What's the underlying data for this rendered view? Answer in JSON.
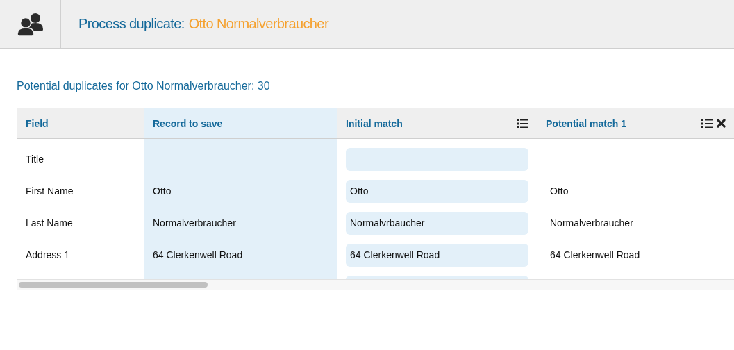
{
  "header": {
    "title": "Process duplicate:",
    "name": "Otto Normalverbraucher"
  },
  "summary": "Potential duplicates for Otto Normalverbraucher: 30",
  "table": {
    "columns": [
      {
        "label": "Field",
        "highlighted": false
      },
      {
        "label": "Record to save",
        "highlighted": true
      },
      {
        "label": "Initial match",
        "highlighted": false,
        "actions": [
          {
            "kind": "list"
          }
        ]
      },
      {
        "label": "Potential match 1",
        "highlighted": false,
        "actions": [
          {
            "kind": "list"
          },
          {
            "kind": "remove"
          }
        ]
      }
    ],
    "rows": [
      {
        "field": "Title"
      },
      {
        "field": "First Name",
        "record": "Otto",
        "initial": "Otto",
        "potential": "Otto"
      },
      {
        "field": "Last Name",
        "record": "Normalverbraucher",
        "initial": "Normalvrbaucher",
        "potential": "Normalverbraucher"
      },
      {
        "field": "Address 1",
        "record": "64 Clerkenwell Road",
        "initial": "64 Clerkenwell Road",
        "potential": "64 Clerkenwell Road"
      },
      {}
    ]
  }
}
